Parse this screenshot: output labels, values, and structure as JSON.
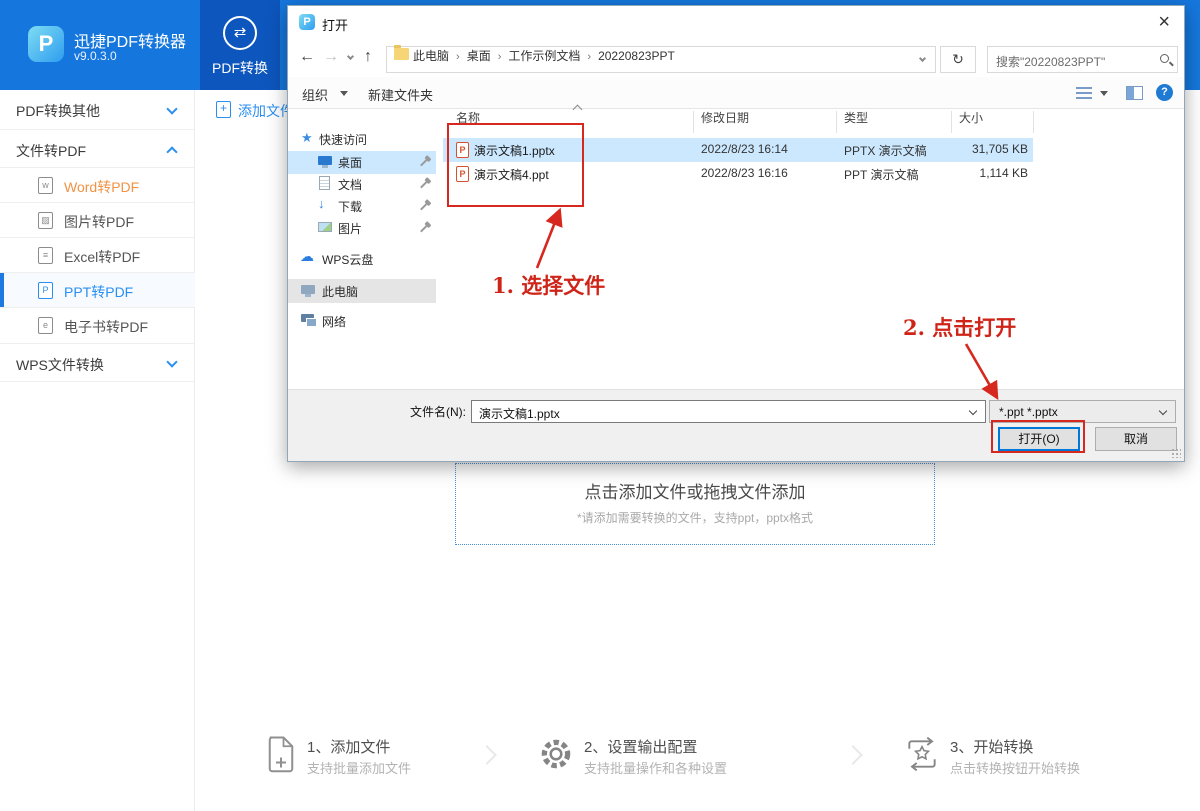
{
  "app": {
    "title": "迅捷PDF转换器",
    "version": "v9.0.3.0",
    "tab_label": "PDF转换",
    "add_files_label": "添加文件"
  },
  "sidebar": {
    "sections": [
      {
        "label": "PDF转换其他"
      },
      {
        "label": "文件转PDF"
      },
      {
        "label": "WPS文件转换"
      }
    ],
    "items": [
      {
        "label": "Word转PDF"
      },
      {
        "label": "图片转PDF"
      },
      {
        "label": "Excel转PDF"
      },
      {
        "label": "PPT转PDF"
      },
      {
        "label": "电子书转PDF"
      }
    ]
  },
  "dialog": {
    "title": "打开",
    "breadcrumb": [
      "此电脑",
      "桌面",
      "工作示例文档",
      "20220823PPT"
    ],
    "search_text": "搜索\"20220823PPT\"",
    "toolbar": {
      "organize": "组织",
      "new_folder": "新建文件夹"
    },
    "nav": {
      "quick_access": "快速访问",
      "desktop": "桌面",
      "documents": "文档",
      "downloads": "下载",
      "pictures": "图片",
      "wps_cloud": "WPS云盘",
      "this_pc": "此电脑",
      "network": "网络"
    },
    "columns": [
      "名称",
      "修改日期",
      "类型",
      "大小"
    ],
    "files": [
      {
        "name": "演示文稿1.pptx",
        "date": "2022/8/23 16:14",
        "type": "PPTX 演示文稿",
        "size": "31,705 KB"
      },
      {
        "name": "演示文稿4.ppt",
        "date": "2022/8/23 16:16",
        "type": "PPT 演示文稿",
        "size": "1,114 KB"
      }
    ],
    "footer": {
      "filename_label": "文件名(N):",
      "filename_value": "演示文稿1.pptx",
      "filetype_value": "*.ppt *.pptx",
      "open_label": "打开(O)",
      "cancel_label": "取消"
    }
  },
  "dropzone": {
    "title": "点击添加文件或拖拽文件添加",
    "subtitle": "*请添加需要转换的文件，支持ppt，pptx格式"
  },
  "steps": [
    {
      "title": "1、添加文件",
      "desc": "支持批量添加文件"
    },
    {
      "title": "2、设置输出配置",
      "desc": "支持批量操作和各种设置"
    },
    {
      "title": "3、开始转换",
      "desc": "点击转换按钮开始转换"
    }
  ],
  "annotations": {
    "step1": "1. 选择文件",
    "step2": "2. 点击打开"
  },
  "colors": {
    "header_blue": "#1577dd",
    "tab_blue": "#0d56bd",
    "accent_blue": "#2a8ff2",
    "annotation_red": "#d6281e",
    "selection_blue": "#cce8ff",
    "word_orange": "#ef9345"
  }
}
